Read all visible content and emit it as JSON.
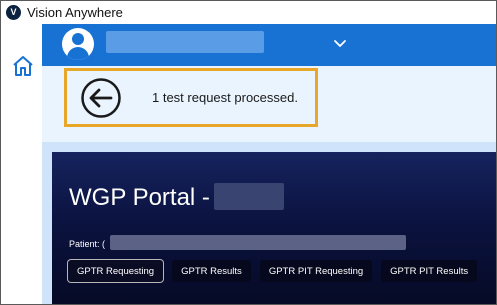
{
  "window": {
    "title": "Vision Anywhere",
    "logo_letter": "V"
  },
  "topbar": {
    "icons": [
      "user-avatar-icon",
      "chevron-down-icon"
    ]
  },
  "notification": {
    "message": "1 test request processed.",
    "highlight_color": "#e9a72a"
  },
  "portal": {
    "title": "WGP Portal -",
    "patient_label": "Patient: (",
    "tabs": [
      {
        "label": "GPTR Requesting",
        "active": true
      },
      {
        "label": "GPTR Results",
        "active": false
      },
      {
        "label": "GPTR PIT Requesting",
        "active": false
      },
      {
        "label": "GPTR PIT Results",
        "active": false
      }
    ]
  },
  "colors": {
    "topbar": "#1872d4",
    "notification_bg": "#eaf4fe",
    "portal_header": "#0b1340"
  }
}
